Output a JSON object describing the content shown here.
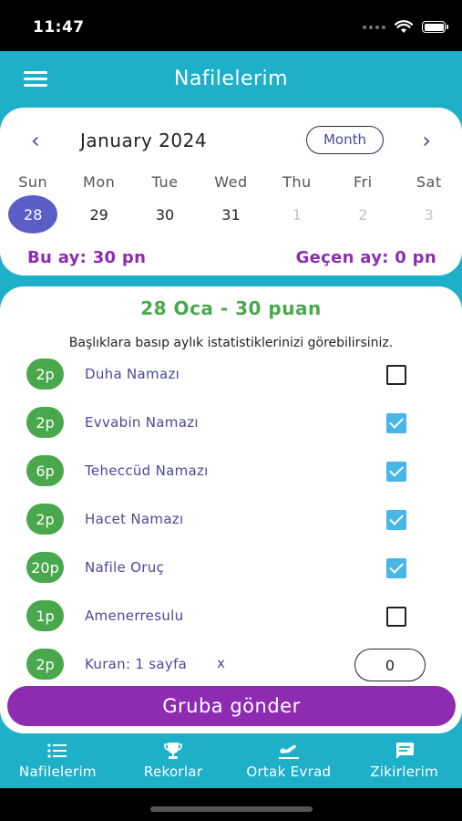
{
  "status_bar": {
    "time": "11:47"
  },
  "header": {
    "title": "Nafilelerim"
  },
  "calendar": {
    "month": "January 2024",
    "mode_label": "Month",
    "weekdays": [
      "Sun",
      "Mon",
      "Tue",
      "Wed",
      "Thu",
      "Fri",
      "Sat"
    ],
    "days": [
      "28",
      "29",
      "30",
      "31",
      "1",
      "2",
      "3"
    ],
    "selected_day": "28",
    "this_month": "Bu ay: 30 pn",
    "last_month": "Geçen ay: 0 pn"
  },
  "list": {
    "heading": "28 Oca - 30 puan",
    "hint": "Başlıklara basıp aylık istatistiklerinizi görebilirsiniz.",
    "items": [
      {
        "points": "2p",
        "label": "Duha Namazı",
        "checked": false
      },
      {
        "points": "2p",
        "label": "Evvabin Namazı",
        "checked": true
      },
      {
        "points": "6p",
        "label": "Teheccüd Namazı",
        "checked": true
      },
      {
        "points": "2p",
        "label": "Hacet Namazı",
        "checked": true
      },
      {
        "points": "20p",
        "label": "Nafile Oruç",
        "checked": true
      },
      {
        "points": "1p",
        "label": "Amenerresulu",
        "checked": false
      },
      {
        "points": "2p",
        "label": "Kuran: 1 sayfa",
        "multiplier": "x",
        "quantity": "0"
      }
    ]
  },
  "send_button": {
    "label": "Gruba gönder"
  },
  "bottom_nav": {
    "items": [
      {
        "label": "Nafilelerim",
        "icon": "list-icon"
      },
      {
        "label": "Rekorlar",
        "icon": "trophy-icon"
      },
      {
        "label": "Ortak Evrad",
        "icon": "airplane-icon"
      },
      {
        "label": "Zikirlerim",
        "icon": "chat-icon"
      }
    ]
  },
  "colors": {
    "primary": "#1eb0c9",
    "accent": "#8e2bb0",
    "success": "#4aa84c",
    "selected_day": "#5a5fc8",
    "checkbox": "#48b6e8"
  }
}
